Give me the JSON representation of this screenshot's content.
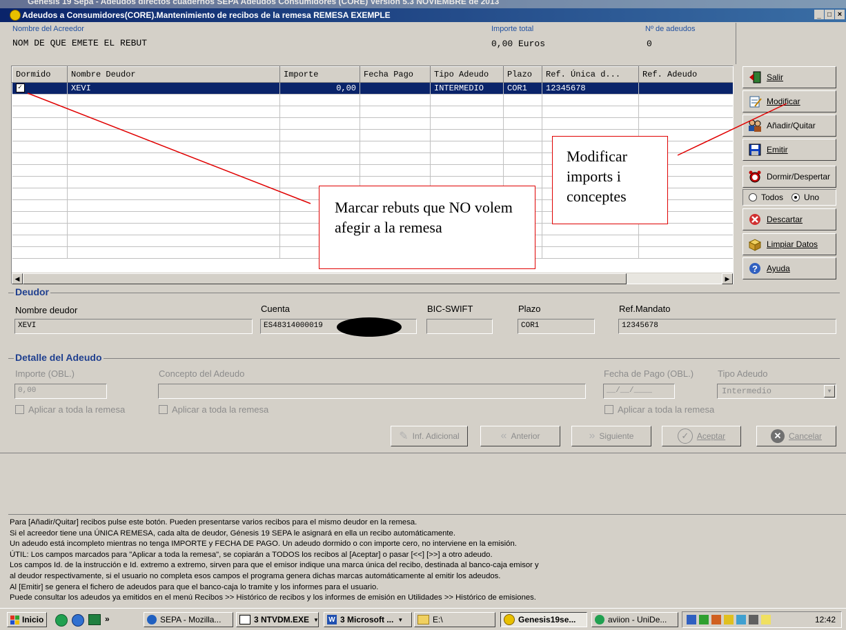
{
  "outer_window": {
    "title": "Génesis 19 Sepa - Adeudos directos cuadernos SEPA Adeudos Consumidores (CORE) Versión 5.3 NOVIEMBRE de 2013"
  },
  "window": {
    "title": "Adeudos a Consumidores(CORE).Mantenimiento de recibos de la remesa REMESA EXEMPLE"
  },
  "header": {
    "creditor_label": "Nombre del Acreedor",
    "creditor_value": "NOM DE QUE EMETE EL REBUT",
    "total_label": "Importe total",
    "total_value": "0,00 Euros",
    "count_label": "Nº de adeudos",
    "count_value": "0"
  },
  "grid": {
    "columns": [
      "Dormido",
      "Nombre Deudor",
      "Importe",
      "Fecha Pago",
      "Tipo Adeudo",
      "Plazo",
      "Ref. Única d...",
      "Ref. Adeudo"
    ],
    "rows": [
      {
        "dormido": true,
        "nombre": "XEVI",
        "importe": "0,00",
        "fecha": "",
        "tipo": "INTERMEDIO",
        "plazo": "COR1",
        "ref_unica": "12345678",
        "ref_adeudo": ""
      }
    ]
  },
  "sidebar": {
    "salir": "Salir",
    "modificar": "Modificar",
    "anadir": "Añadir/Quitar",
    "emitir": "Emitir",
    "dormir": "Dormir/Despertar",
    "todos": "Todos",
    "uno": "Uno",
    "descartar": "Descartar",
    "limpiar": "Limpiar Datos",
    "ayuda": "Ayuda"
  },
  "deudor": {
    "section": "Deudor",
    "nombre_label": "Nombre deudor",
    "nombre_value": "XEVI",
    "cuenta_label": "Cuenta",
    "cuenta_value": "ES48314000019",
    "bic_label": "BIC-SWIFT",
    "bic_value": "",
    "plazo_label": "Plazo",
    "plazo_value": "COR1",
    "ref_label": "Ref.Mandato",
    "ref_value": "12345678"
  },
  "detalle": {
    "section": "Detalle del Adeudo",
    "importe_label": "Importe (OBL.)",
    "importe_value": "0,00",
    "concepto_label": "Concepto del Adeudo",
    "fecha_label": "Fecha de Pago (OBL.)",
    "fecha_value": "__/__/____",
    "tipo_label": "Tipo Adeudo",
    "tipo_value": "Intermedio",
    "aplicar": "Aplicar a toda la remesa",
    "btn_inf": "Inf. Adicional",
    "btn_anterior": "Anterior",
    "btn_siguiente": "Siguiente",
    "btn_aceptar": "Aceptar",
    "btn_cancelar": "Cancelar"
  },
  "help_lines": [
    "Para [Añadir/Quitar] recibos pulse este botón. Pueden presentarse varios recibos para el mismo deudor en la remesa.",
    "Si el acreedor tiene una ÚNICA REMESA, cada alta de deudor, Génesis 19 SEPA le asignará en ella un recibo automáticamente.",
    "Un adeudo está incompleto mientras no tenga IMPORTE y FECHA DE PAGO. Un adeudo dormido o con importe cero, no interviene en la emisión.",
    "ÚTIL: Los campos marcados para \"Aplicar a toda la remesa\", se copiarán a TODOS los recibos al [Aceptar] o pasar [<<] [>>] a otro adeudo.",
    "Los campos Id. de la instrucción e Id. extremo a extremo, sirven para que el emisor indique una marca única del recibo, destinada al banco-caja emisor y",
    "al deudor respectivamente, si el usuario no completa esos campos el programa genera dichas marcas automáticamente al emitir los adeudos.",
    "Al [Emitir] se genera el fichero de adeudos para que el banco-caja lo tramite y los informes para el usuario.",
    "Puede consultar los adeudos ya emitidos en el menú Recibos >> Histórico de recibos y los informes de emisión en Utilidades >> Histórico de emisiones."
  ],
  "callouts": {
    "left": "Marcar rebuts que NO volem afegir a la remesa",
    "right": "Modificar imports i conceptes"
  },
  "taskbar": {
    "start": "Inicio",
    "t1": "SEPA - Mozilla...",
    "t2": "3 NTVDM.EXE",
    "t3": "3 Microsoft ...",
    "t4": "E:\\",
    "t5": "Genesis19se...",
    "t6": "aviion - UniDe...",
    "clock": "12:42"
  },
  "colors": {
    "title_start": "#0a246a",
    "title_end": "#3a6ea5",
    "face": "#d4d0c8",
    "annotation": "#e00000"
  }
}
